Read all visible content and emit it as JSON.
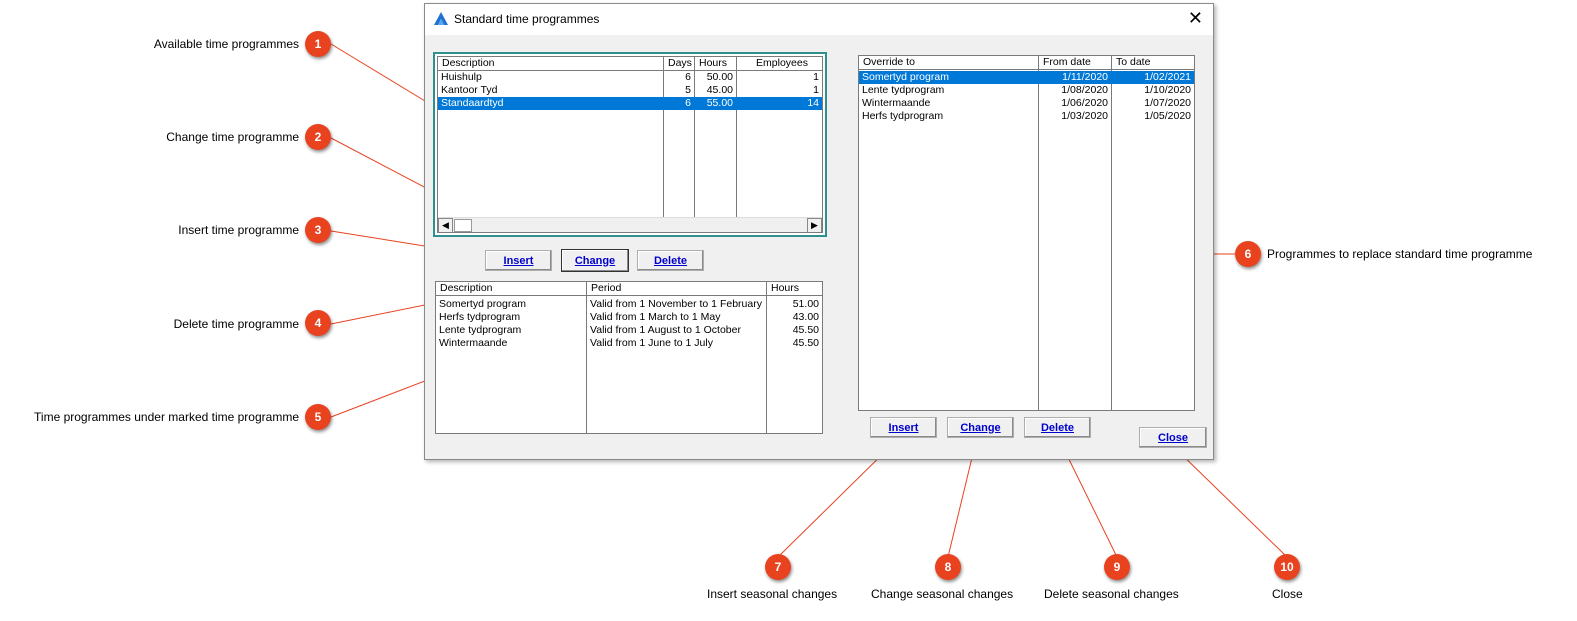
{
  "dialog": {
    "title": "Standard time programmes"
  },
  "programmes": {
    "headers": [
      "Description",
      "Days",
      "Hours",
      "Employees"
    ],
    "rows": [
      [
        "Huishulp",
        "6",
        "50.00",
        "1"
      ],
      [
        "Kantoor Tyd",
        "5",
        "45.00",
        "1"
      ],
      [
        "Standaardtyd",
        "6",
        "55.00",
        "14"
      ]
    ],
    "selected_row": 2
  },
  "buttons_left": {
    "insert": "Insert",
    "change": "Change",
    "delete": "Delete"
  },
  "seasonal": {
    "headers": [
      "Description",
      "Period",
      "Hours"
    ],
    "rows": [
      [
        "Somertyd program",
        "Valid from 1 November to 1 February",
        "51.00"
      ],
      [
        "Herfs tydprogram",
        "Valid from 1 March to 1 May",
        "43.00"
      ],
      [
        "Lente tydprogram",
        "Valid from 1 August to 1 October",
        "45.50"
      ],
      [
        "Wintermaande",
        "Valid from 1 June to 1 July",
        "45.50"
      ]
    ]
  },
  "overrides": {
    "headers": [
      "Override to",
      "From date",
      "To date"
    ],
    "rows": [
      [
        "Somertyd program",
        "1/11/2020",
        "1/02/2021"
      ],
      [
        "Lente tydprogram",
        "1/08/2020",
        "1/10/2020"
      ],
      [
        "Wintermaande",
        "1/06/2020",
        "1/07/2020"
      ],
      [
        "Herfs tydprogram",
        "1/03/2020",
        "1/05/2020"
      ]
    ],
    "selected_row": 0
  },
  "buttons_right": {
    "insert": "Insert",
    "change": "Change",
    "delete": "Delete",
    "close": "Close"
  },
  "callouts": [
    {
      "num": "1",
      "label": "Available time programmes"
    },
    {
      "num": "2",
      "label": "Change time programme"
    },
    {
      "num": "3",
      "label": "Insert time programme"
    },
    {
      "num": "4",
      "label": "Delete time programme"
    },
    {
      "num": "5",
      "label": "Time programmes under marked time programme"
    },
    {
      "num": "6",
      "label": "Programmes to replace standard time programme"
    },
    {
      "num": "7",
      "label": "Insert seasonal changes"
    },
    {
      "num": "8",
      "label": "Change seasonal changes"
    },
    {
      "num": "9",
      "label": "Delete seasonal changes"
    },
    {
      "num": "10",
      "label": "Close"
    }
  ],
  "colors": {
    "badge": "#e8421f",
    "line": "#e8421f",
    "selection": "#0078d7",
    "button_text": "#0000cc"
  },
  "icons": {
    "logo": "app-logo-icon",
    "close": "close-icon",
    "scroll_left": "arrow-left-icon",
    "scroll_right": "arrow-right-icon"
  }
}
